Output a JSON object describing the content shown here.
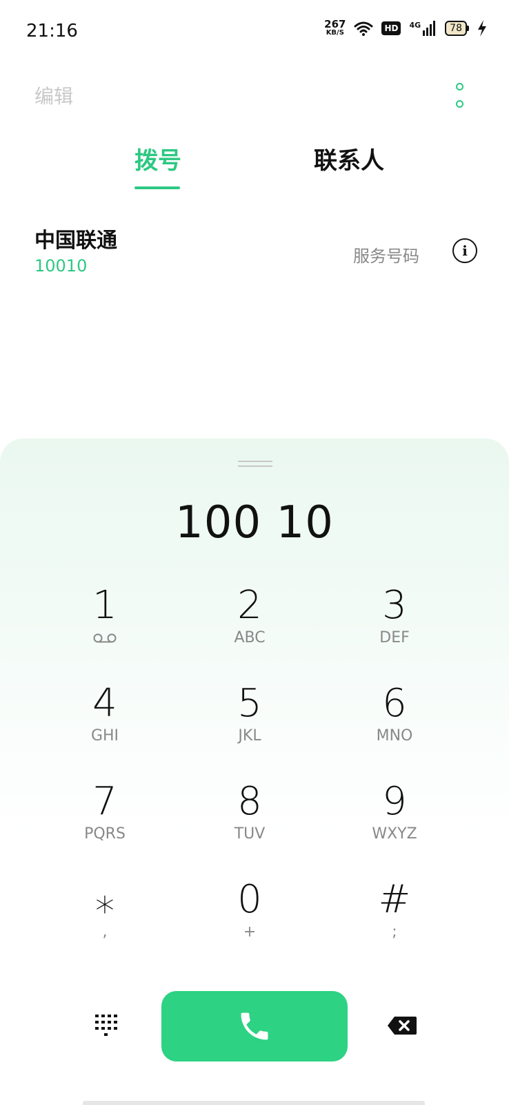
{
  "status_bar": {
    "time": "21:16",
    "net_speed_value": "267",
    "net_speed_unit": "KB/S",
    "hd_label": "HD",
    "network_label": "4G",
    "battery_level": "78"
  },
  "header": {
    "edit_label": "编辑",
    "more_icon": "more-vertical-icon"
  },
  "tabs": [
    {
      "label": "拨号",
      "active": true
    },
    {
      "label": "联系人",
      "active": false
    }
  ],
  "result": {
    "name": "中国联通",
    "number": "10010",
    "tag": "服务号码",
    "info_icon": "info-icon"
  },
  "dialpad": {
    "number": "100 10",
    "keys": [
      {
        "digit": "1",
        "letters": ""
      },
      {
        "digit": "2",
        "letters": "ABC"
      },
      {
        "digit": "3",
        "letters": "DEF"
      },
      {
        "digit": "4",
        "letters": "GHI"
      },
      {
        "digit": "5",
        "letters": "JKL"
      },
      {
        "digit": "6",
        "letters": "MNO"
      },
      {
        "digit": "7",
        "letters": "PQRS"
      },
      {
        "digit": "8",
        "letters": "TUV"
      },
      {
        "digit": "9",
        "letters": "WXYZ"
      },
      {
        "digit": "⁎",
        "letters": ","
      },
      {
        "digit": "0",
        "letters": "+"
      },
      {
        "digit": "#",
        "letters": ";"
      }
    ]
  },
  "actions": {
    "dialpad_toggle_icon": "dialpad-icon",
    "call_icon": "phone-icon",
    "backspace_icon": "backspace-icon"
  },
  "colors": {
    "accent": "#2dc882",
    "call_button": "#2dd283"
  }
}
